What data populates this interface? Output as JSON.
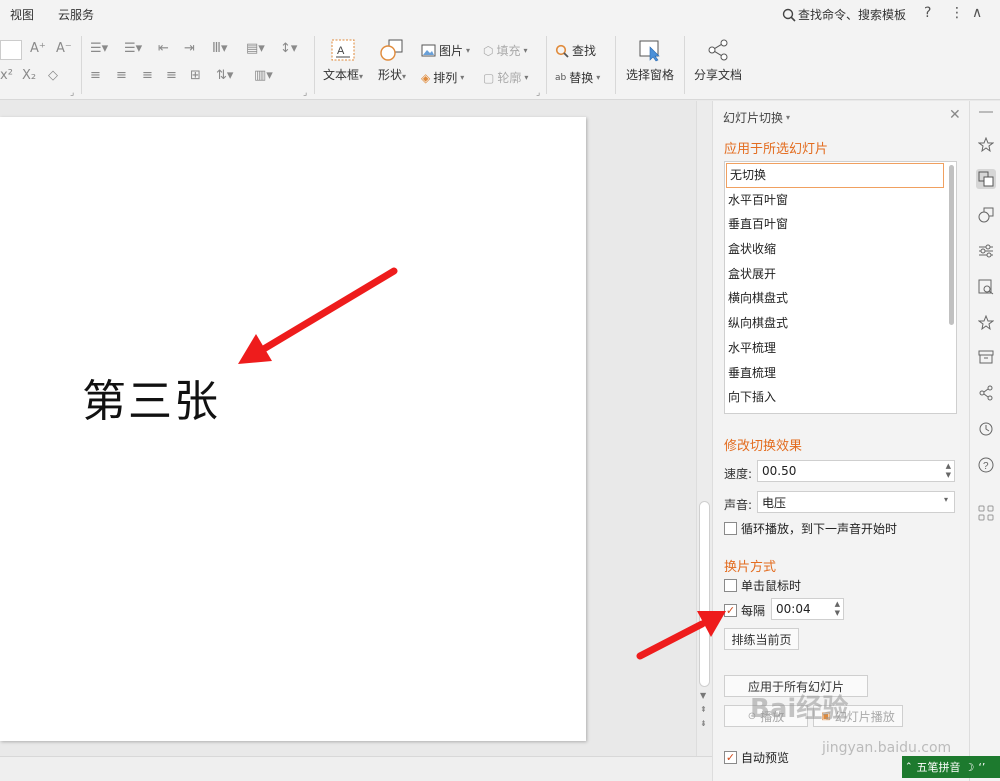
{
  "menu": {
    "items": [
      "视图",
      "云服务"
    ],
    "search_label": "查找命令、搜索模板"
  },
  "ribbon": {
    "text_box": "文本框",
    "shapes": "形状",
    "picture": "图片",
    "arrange": "排列",
    "fill": "填充",
    "outline": "轮廓",
    "find": "查找",
    "replace": "替换",
    "selection_pane": "选择窗格",
    "share_doc": "分享文档"
  },
  "slide": {
    "text": "第三张"
  },
  "pane": {
    "title": "幻灯片切换",
    "section_apply": "应用于所选幻灯片",
    "transitions": [
      "无切换",
      "水平百叶窗",
      "垂直百叶窗",
      "盒状收缩",
      "盒状展开",
      "横向棋盘式",
      "纵向棋盘式",
      "水平梳理",
      "垂直梳理",
      "向下插入"
    ],
    "selected_transition": "无切换",
    "section_modify": "修改切换效果",
    "speed_label": "速度:",
    "speed_value": "00.50",
    "sound_label": "声音:",
    "sound_value": "电压",
    "loop_label": "循环播放，到下一声音开始时",
    "loop_checked": false,
    "section_advance": "换片方式",
    "on_click_label": "单击鼠标时",
    "on_click_checked": false,
    "every_label": "每隔",
    "every_checked": true,
    "every_value": "00:04",
    "rehearse_button": "排练当前页",
    "apply_all_button": "应用于所有幻灯片",
    "play_button": "播放",
    "slideshow_button": "幻灯片播放",
    "autopreview_label": "自动预览",
    "autopreview_checked": true
  },
  "ime": {
    "label": "五笔拼音"
  },
  "watermark": {
    "brand": "Bai经验",
    "url": "jingyan.baidu.com"
  },
  "colors": {
    "accent": "#e36c1f",
    "arrow": "#ee1c1c",
    "ime_bg": "#1d7a2e"
  }
}
